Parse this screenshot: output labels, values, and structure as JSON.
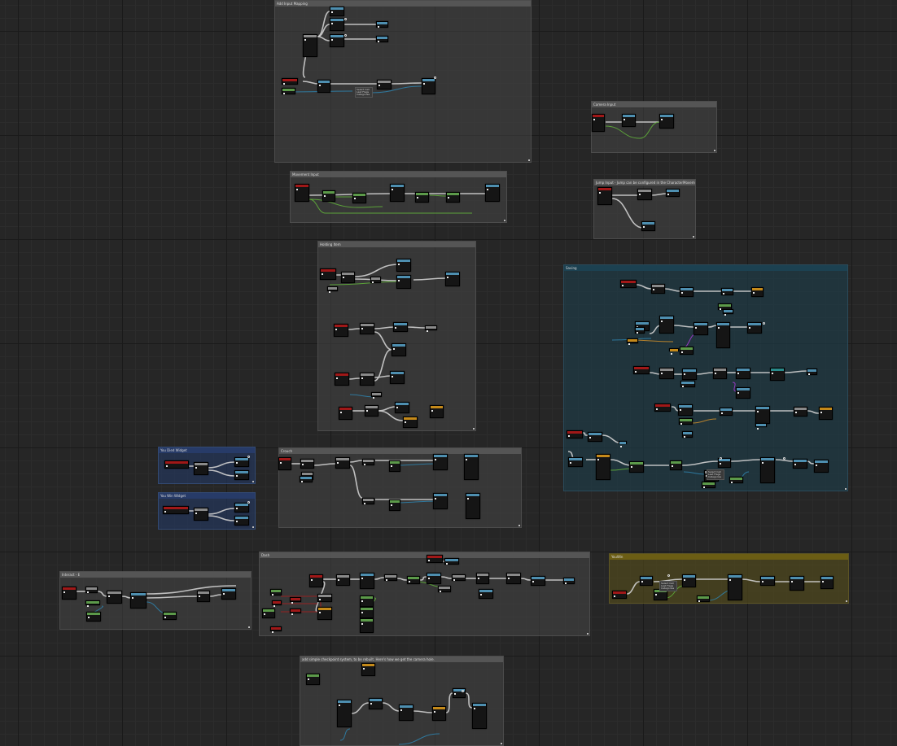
{
  "comments": [
    {
      "id": "add-input-mapping",
      "title": "Add Input Mapping",
      "style": "gray"
    },
    {
      "id": "camera-input",
      "title": "Camera Input",
      "style": "gray"
    },
    {
      "id": "movement-input",
      "title": "Movement Input",
      "style": "gray"
    },
    {
      "id": "jump-input",
      "title": "Jump Input - Jump can be configured in the CharacterMovementComponent",
      "style": "gray"
    },
    {
      "id": "holding-item",
      "title": "Holding Item",
      "style": "gray"
    },
    {
      "id": "saving",
      "title": "Saving",
      "style": "teal"
    },
    {
      "id": "you-died-widget",
      "title": "You Died Widget",
      "style": "blue"
    },
    {
      "id": "you-win-widget",
      "title": "You Win Widget",
      "style": "blue"
    },
    {
      "id": "crouch",
      "title": "Crouch",
      "style": "gray"
    },
    {
      "id": "interact-e",
      "title": "Interact - E",
      "style": "gray"
    },
    {
      "id": "dash",
      "title": "Dash",
      "style": "gray"
    },
    {
      "id": "you-win",
      "title": "YouWin",
      "style": "olive"
    },
    {
      "id": "checkpoint",
      "title": "add simple checkpoint system, to be rebuilt. Here's how we get the camera hole.",
      "style": "gray"
    }
  ],
  "wire_labels": [
    {
      "id": "note-1",
      "text": "Select Call Last Flags Categories"
    },
    {
      "id": "note-2",
      "text": "Select Call Last Flags Categories"
    },
    {
      "id": "note-3",
      "text": "Select Call Last Flags Categories"
    }
  ],
  "colors": {
    "event": "#a01818",
    "function": "#4e8fb0",
    "pure": "#5c9a4a",
    "macro": "#8a8a8a",
    "custom": "#c58a1a",
    "cast": "#2a8a8a",
    "exec_wire": "#cfcfcf",
    "data_wire": "#2f7fa8",
    "float_wire": "#5fae3a",
    "bool_wire": "#a12020",
    "object_wire": "#2f6fa0",
    "struct_wire": "#c5892a",
    "purple_wire": "#a43ad1"
  }
}
